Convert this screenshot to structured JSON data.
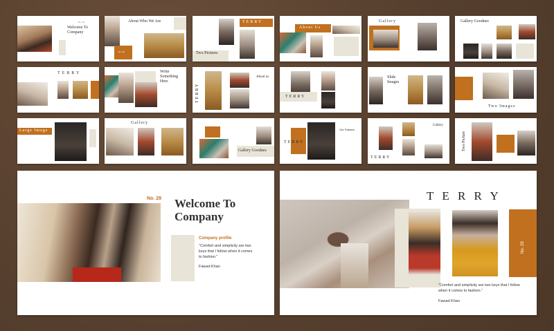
{
  "slides": {
    "s1": {
      "title": "Welcome To Company",
      "num": "No. 29"
    },
    "s2": {
      "title": "About  Who We Are",
      "num": "No. 29"
    },
    "s3": {
      "title": "TERRY",
      "sub": "Two Pictures"
    },
    "s4": {
      "title": "About Us"
    },
    "s5": {
      "title": "Gallery"
    },
    "s6": {
      "title": "Gallery Goodnes"
    },
    "s7": {
      "title": "TERRY"
    },
    "s8": {
      "title": "Write Something Here"
    },
    "s9": {
      "vertical": "TERRY",
      "title": "About us"
    },
    "s10": {
      "title": "TERRY"
    },
    "s11": {
      "title": "Slide Images"
    },
    "s12": {
      "title": "Two Images"
    },
    "s13": {
      "title": "Large Image"
    },
    "s14": {
      "title": "Gallery"
    },
    "s15": {
      "title": "Gallery Goodnes"
    },
    "s16": {
      "title": "TERRY",
      "sub": "Our Passion"
    },
    "s17": {
      "title": "TERRY",
      "sub": "Gallery"
    },
    "s18": {
      "title": "Two Picture"
    }
  },
  "big_left": {
    "num": "No. 29",
    "title_line1": "Welcome To",
    "title_line2": "Company",
    "profile_label": "Company profile",
    "quote": "\"Comfort and simplicity are two keys that I follow when it comes to fashion.\"",
    "author": "Fawad Khan"
  },
  "big_right": {
    "title": "T E R R Y",
    "num": "No. 29",
    "quote": "\"Comfort and simplicity are two keys that I follow when it comes to fashion.\"",
    "author": "Fawad Khan"
  },
  "colors": {
    "accent": "#c0701e",
    "beige": "#e8e4d7",
    "background": "#5b4331"
  }
}
